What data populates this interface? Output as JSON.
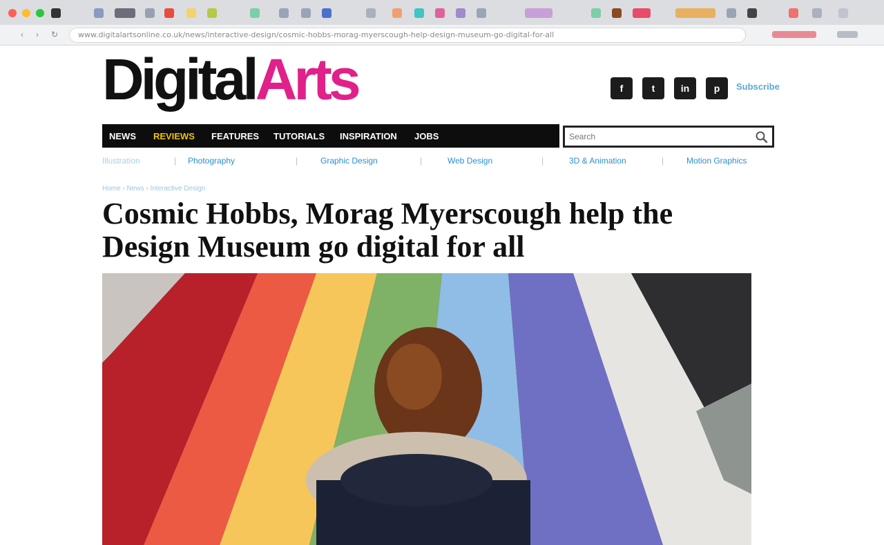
{
  "browser": {
    "url": "www.digitalartsonline.co.uk/news/interactive-design/cosmic-hobbs-morag-myerscough-help-design-museum-go-digital-for-all"
  },
  "site": {
    "logo_part1": "Digital",
    "logo_part2": "Arts",
    "subscribe_label": "Subscribe",
    "social": [
      "f",
      "t",
      "in",
      "p"
    ]
  },
  "nav": {
    "items": [
      "NEWS",
      "REVIEWS",
      "FEATURES",
      "TUTORIALS",
      "INSPIRATION",
      "JOBS"
    ],
    "search_placeholder": "Search"
  },
  "subnav": {
    "items": [
      "Illustration",
      "Photography",
      "Graphic Design",
      "Web Design",
      "3D & Animation",
      "Motion Graphics"
    ]
  },
  "article": {
    "breadcrumb": "Home › News › Interactive Design",
    "headline": "Cosmic Hobbs, Morag Myerscough help the Design Museum go digital for all"
  },
  "colors": {
    "brand_pink": "#e0218a",
    "nav_black": "#0d0d0d",
    "link_blue": "#2a8fd0"
  }
}
